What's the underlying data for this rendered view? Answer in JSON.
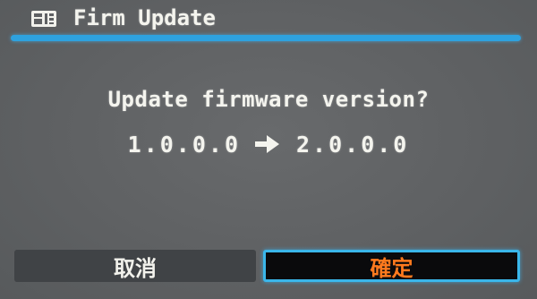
{
  "header": {
    "title": "Firm Update",
    "icon": "settings-menu-icon"
  },
  "dialog": {
    "message": "Update firmware version?",
    "current_version": "1.0.0.0",
    "arrow_icon": "right-arrow-icon",
    "new_version": "2.0.0.0"
  },
  "buttons": {
    "cancel_label": "取消",
    "ok_label": "確定"
  },
  "colors": {
    "accent_line": "#2ea2df",
    "selected_text": "#ff7a1e",
    "selected_border": "#3ab6ea",
    "background": "#5f6163"
  }
}
